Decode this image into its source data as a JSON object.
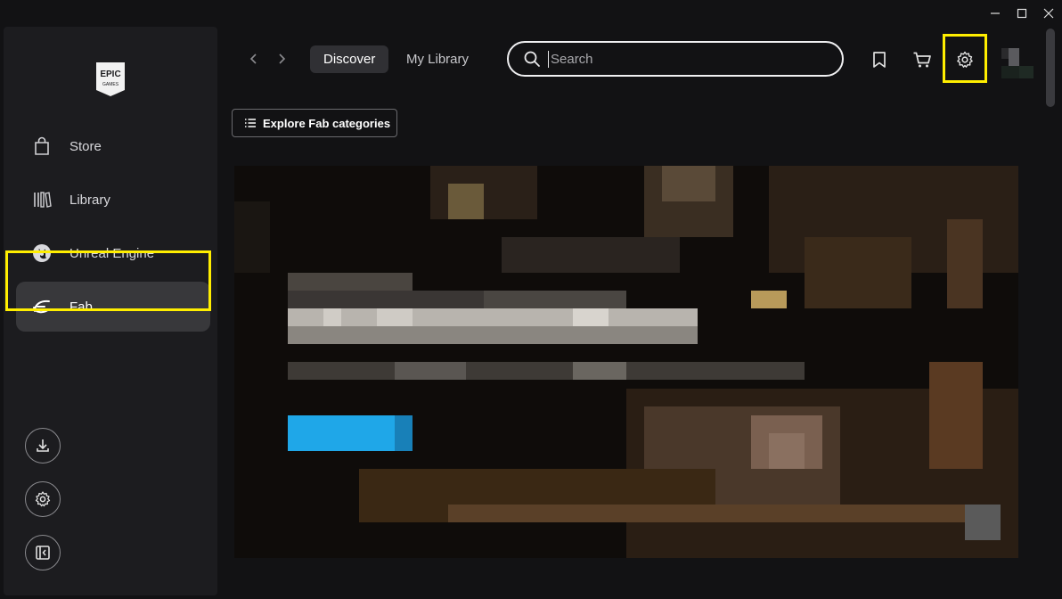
{
  "window": {
    "controls": [
      "minimize-icon",
      "maximize-icon",
      "close-icon"
    ]
  },
  "sidebar": {
    "logo": {
      "line1": "EPIC",
      "line2": "GAMES"
    },
    "items": [
      {
        "label": "Store",
        "icon": "store-bag-icon"
      },
      {
        "label": "Library",
        "icon": "library-icon"
      },
      {
        "label": "Unreal Engine",
        "icon": "unreal-engine-icon"
      },
      {
        "label": "Fab",
        "icon": "fab-icon",
        "active": true
      }
    ],
    "bottom_buttons": [
      "download-icon",
      "gear-icon",
      "collapse-sidebar-icon"
    ]
  },
  "topbar": {
    "tabs": [
      {
        "label": "Discover",
        "active": true
      },
      {
        "label": "My Library",
        "active": false
      }
    ],
    "search": {
      "placeholder": "Search",
      "value": ""
    },
    "icons": [
      "bookmark-icon",
      "cart-icon",
      "gear-icon"
    ]
  },
  "content": {
    "explore_label": "Explore Fab categories"
  },
  "colors": {
    "accent_highlight": "#ffee00",
    "cta_blue": "#1fa7e8",
    "background": "#121214",
    "sidebar": "#1c1c1f"
  }
}
